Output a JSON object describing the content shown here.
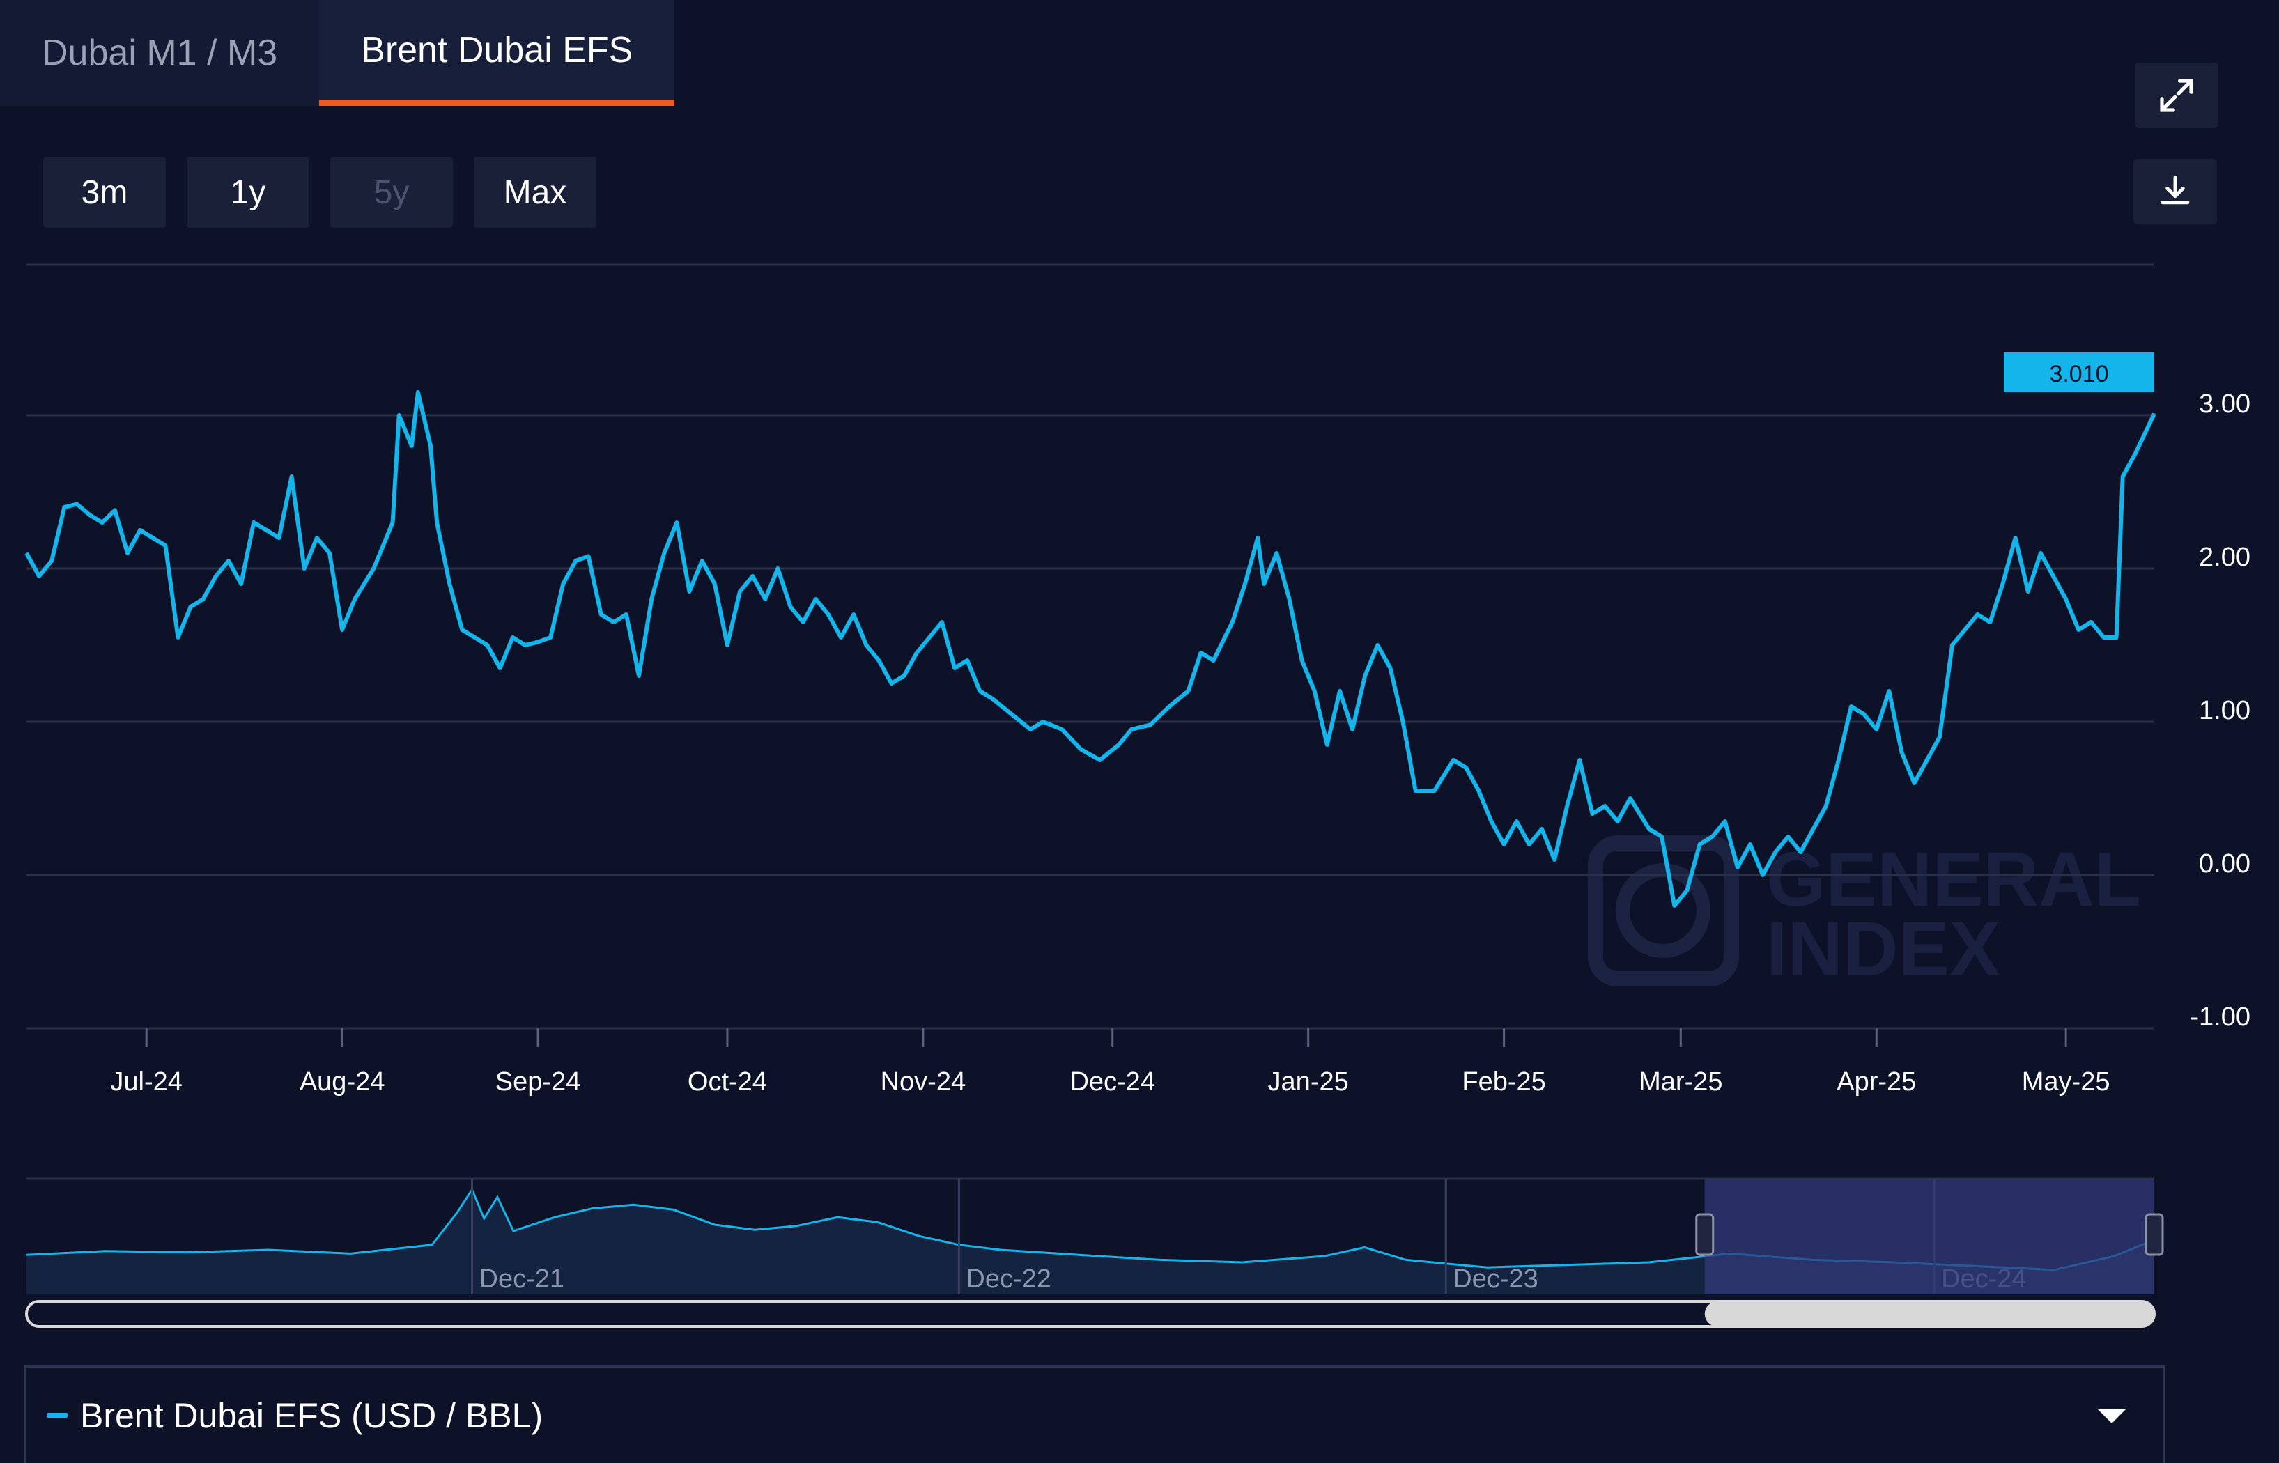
{
  "tabs": [
    {
      "label": "Dubai M1 / M3",
      "active": false
    },
    {
      "label": "Brent Dubai EFS",
      "active": true
    }
  ],
  "range_buttons": [
    {
      "label": "3m",
      "disabled": false
    },
    {
      "label": "1y",
      "disabled": false
    },
    {
      "label": "5y",
      "disabled": true
    },
    {
      "label": "Max",
      "disabled": false
    }
  ],
  "icons": {
    "expand": "expand-icon",
    "download": "download-icon",
    "dropdown": "chevron-down-icon"
  },
  "colors": {
    "background": "#0d1229",
    "series": "#13b5ea",
    "tab_active": "#f05a1e",
    "navigator_selection": "#323a7a"
  },
  "watermark": {
    "line1": "GENERAL",
    "line2": "INDEX"
  },
  "legend": {
    "label": "Brent Dubai EFS (USD / BBL)"
  },
  "chart_data": {
    "type": "line",
    "title": "",
    "xlabel": "",
    "ylabel": "",
    "ylim": [
      -1.0,
      3.9
    ],
    "yticks": [
      "3.00",
      "2.00",
      "1.00",
      "0.00",
      "-1.00"
    ],
    "xticks": [
      "Jul-24",
      "Aug-24",
      "Sep-24",
      "Oct-24",
      "Nov-24",
      "Dec-24",
      "Jan-25",
      "Feb-25",
      "Mar-25",
      "Apr-25",
      "May-25"
    ],
    "last_value_label": "3.010",
    "grid": true,
    "series": [
      {
        "name": "Brent Dubai EFS (USD / BBL)",
        "points": [
          [
            "2024-06-12",
            2.1
          ],
          [
            "2024-06-14",
            1.95
          ],
          [
            "2024-06-16",
            2.05
          ],
          [
            "2024-06-18",
            2.4
          ],
          [
            "2024-06-20",
            2.42
          ],
          [
            "2024-06-22",
            2.35
          ],
          [
            "2024-06-24",
            2.3
          ],
          [
            "2024-06-26",
            2.38
          ],
          [
            "2024-06-28",
            2.1
          ],
          [
            "2024-06-30",
            2.25
          ],
          [
            "2024-07-02",
            2.2
          ],
          [
            "2024-07-04",
            2.15
          ],
          [
            "2024-07-06",
            1.55
          ],
          [
            "2024-07-08",
            1.75
          ],
          [
            "2024-07-10",
            1.8
          ],
          [
            "2024-07-12",
            1.95
          ],
          [
            "2024-07-14",
            2.05
          ],
          [
            "2024-07-16",
            1.9
          ],
          [
            "2024-07-18",
            2.3
          ],
          [
            "2024-07-20",
            2.25
          ],
          [
            "2024-07-22",
            2.2
          ],
          [
            "2024-07-24",
            2.6
          ],
          [
            "2024-07-26",
            2.0
          ],
          [
            "2024-07-28",
            2.2
          ],
          [
            "2024-07-30",
            2.1
          ],
          [
            "2024-08-01",
            1.6
          ],
          [
            "2024-08-03",
            1.8
          ],
          [
            "2024-08-06",
            2.0
          ],
          [
            "2024-08-09",
            2.3
          ],
          [
            "2024-08-10",
            3.0
          ],
          [
            "2024-08-12",
            2.8
          ],
          [
            "2024-08-13",
            3.15
          ],
          [
            "2024-08-15",
            2.8
          ],
          [
            "2024-08-16",
            2.3
          ],
          [
            "2024-08-18",
            1.9
          ],
          [
            "2024-08-20",
            1.6
          ],
          [
            "2024-08-22",
            1.55
          ],
          [
            "2024-08-24",
            1.5
          ],
          [
            "2024-08-26",
            1.35
          ],
          [
            "2024-08-28",
            1.55
          ],
          [
            "2024-08-30",
            1.5
          ],
          [
            "2024-09-01",
            1.52
          ],
          [
            "2024-09-03",
            1.55
          ],
          [
            "2024-09-05",
            1.9
          ],
          [
            "2024-09-07",
            2.05
          ],
          [
            "2024-09-09",
            2.08
          ],
          [
            "2024-09-11",
            1.7
          ],
          [
            "2024-09-13",
            1.65
          ],
          [
            "2024-09-15",
            1.7
          ],
          [
            "2024-09-17",
            1.3
          ],
          [
            "2024-09-19",
            1.8
          ],
          [
            "2024-09-21",
            2.1
          ],
          [
            "2024-09-23",
            2.3
          ],
          [
            "2024-09-25",
            1.85
          ],
          [
            "2024-09-27",
            2.05
          ],
          [
            "2024-09-29",
            1.9
          ],
          [
            "2024-10-01",
            1.5
          ],
          [
            "2024-10-03",
            1.85
          ],
          [
            "2024-10-05",
            1.95
          ],
          [
            "2024-10-07",
            1.8
          ],
          [
            "2024-10-09",
            2.0
          ],
          [
            "2024-10-11",
            1.75
          ],
          [
            "2024-10-13",
            1.65
          ],
          [
            "2024-10-15",
            1.8
          ],
          [
            "2024-10-17",
            1.7
          ],
          [
            "2024-10-19",
            1.55
          ],
          [
            "2024-10-21",
            1.7
          ],
          [
            "2024-10-23",
            1.5
          ],
          [
            "2024-10-25",
            1.4
          ],
          [
            "2024-10-27",
            1.25
          ],
          [
            "2024-10-29",
            1.3
          ],
          [
            "2024-10-31",
            1.45
          ],
          [
            "2024-11-02",
            1.55
          ],
          [
            "2024-11-04",
            1.65
          ],
          [
            "2024-11-06",
            1.35
          ],
          [
            "2024-11-08",
            1.4
          ],
          [
            "2024-11-10",
            1.2
          ],
          [
            "2024-11-12",
            1.15
          ],
          [
            "2024-11-15",
            1.05
          ],
          [
            "2024-11-18",
            0.95
          ],
          [
            "2024-11-20",
            1.0
          ],
          [
            "2024-11-23",
            0.95
          ],
          [
            "2024-11-26",
            0.82
          ],
          [
            "2024-11-29",
            0.75
          ],
          [
            "2024-12-02",
            0.85
          ],
          [
            "2024-12-04",
            0.95
          ],
          [
            "2024-12-07",
            0.98
          ],
          [
            "2024-12-10",
            1.1
          ],
          [
            "2024-12-13",
            1.2
          ],
          [
            "2024-12-15",
            1.45
          ],
          [
            "2024-12-17",
            1.4
          ],
          [
            "2024-12-20",
            1.65
          ],
          [
            "2024-12-22",
            1.9
          ],
          [
            "2024-12-24",
            2.2
          ],
          [
            "2024-12-25",
            1.9
          ],
          [
            "2024-12-27",
            2.1
          ],
          [
            "2024-12-29",
            1.8
          ],
          [
            "2024-12-31",
            1.4
          ],
          [
            "2025-01-02",
            1.2
          ],
          [
            "2025-01-04",
            0.85
          ],
          [
            "2025-01-06",
            1.2
          ],
          [
            "2025-01-08",
            0.95
          ],
          [
            "2025-01-10",
            1.3
          ],
          [
            "2025-01-12",
            1.5
          ],
          [
            "2025-01-14",
            1.35
          ],
          [
            "2025-01-16",
            1.0
          ],
          [
            "2025-01-18",
            0.55
          ],
          [
            "2025-01-21",
            0.55
          ],
          [
            "2025-01-24",
            0.75
          ],
          [
            "2025-01-26",
            0.7
          ],
          [
            "2025-01-28",
            0.55
          ],
          [
            "2025-01-30",
            0.35
          ],
          [
            "2025-02-01",
            0.2
          ],
          [
            "2025-02-03",
            0.35
          ],
          [
            "2025-02-05",
            0.2
          ],
          [
            "2025-02-07",
            0.3
          ],
          [
            "2025-02-09",
            0.1
          ],
          [
            "2025-02-11",
            0.45
          ],
          [
            "2025-02-13",
            0.75
          ],
          [
            "2025-02-15",
            0.4
          ],
          [
            "2025-02-17",
            0.45
          ],
          [
            "2025-02-19",
            0.35
          ],
          [
            "2025-02-21",
            0.5
          ],
          [
            "2025-02-24",
            0.3
          ],
          [
            "2025-02-26",
            0.25
          ],
          [
            "2025-02-28",
            -0.2
          ],
          [
            "2025-03-02",
            -0.1
          ],
          [
            "2025-03-04",
            0.2
          ],
          [
            "2025-03-06",
            0.25
          ],
          [
            "2025-03-08",
            0.35
          ],
          [
            "2025-03-10",
            0.05
          ],
          [
            "2025-03-12",
            0.2
          ],
          [
            "2025-03-14",
            0.0
          ],
          [
            "2025-03-16",
            0.15
          ],
          [
            "2025-03-18",
            0.25
          ],
          [
            "2025-03-20",
            0.15
          ],
          [
            "2025-03-22",
            0.3
          ],
          [
            "2025-03-24",
            0.45
          ],
          [
            "2025-03-26",
            0.75
          ],
          [
            "2025-03-28",
            1.1
          ],
          [
            "2025-03-30",
            1.05
          ],
          [
            "2025-04-01",
            0.95
          ],
          [
            "2025-04-03",
            1.2
          ],
          [
            "2025-04-05",
            0.8
          ],
          [
            "2025-04-07",
            0.6
          ],
          [
            "2025-04-09",
            0.75
          ],
          [
            "2025-04-11",
            0.9
          ],
          [
            "2025-04-13",
            1.5
          ],
          [
            "2025-04-15",
            1.6
          ],
          [
            "2025-04-17",
            1.7
          ],
          [
            "2025-04-19",
            1.65
          ],
          [
            "2025-04-21",
            1.9
          ],
          [
            "2025-04-23",
            2.2
          ],
          [
            "2025-04-25",
            1.85
          ],
          [
            "2025-04-27",
            2.1
          ],
          [
            "2025-04-29",
            1.95
          ],
          [
            "2025-05-01",
            1.8
          ],
          [
            "2025-05-03",
            1.6
          ],
          [
            "2025-05-05",
            1.65
          ],
          [
            "2025-05-07",
            1.55
          ],
          [
            "2025-05-09",
            1.55
          ],
          [
            "2025-05-10",
            2.6
          ],
          [
            "2025-05-12",
            2.75
          ],
          [
            "2025-05-15",
            3.01
          ]
        ]
      }
    ],
    "navigator": {
      "labels": [
        "Dec-21",
        "Dec-22",
        "Dec-23",
        "Dec-24"
      ],
      "x_start": "2021-01-01",
      "x_end": "2025-05-15",
      "selection": [
        "2024-06-12",
        "2025-05-15"
      ],
      "values": [
        [
          "2021-01-01",
          1.6
        ],
        [
          "2021-03-01",
          1.9
        ],
        [
          "2021-05-01",
          1.8
        ],
        [
          "2021-07-01",
          2.0
        ],
        [
          "2021-09-01",
          1.7
        ],
        [
          "2021-11-01",
          2.4
        ],
        [
          "2021-11-20",
          5.0
        ],
        [
          "2021-12-01",
          6.8
        ],
        [
          "2021-12-10",
          4.5
        ],
        [
          "2021-12-20",
          6.2
        ],
        [
          "2022-01-01",
          3.5
        ],
        [
          "2022-02-01",
          4.6
        ],
        [
          "2022-03-01",
          5.3
        ],
        [
          "2022-04-01",
          5.6
        ],
        [
          "2022-05-01",
          5.2
        ],
        [
          "2022-06-01",
          4.0
        ],
        [
          "2022-07-01",
          3.6
        ],
        [
          "2022-08-01",
          3.9
        ],
        [
          "2022-09-01",
          4.6
        ],
        [
          "2022-10-01",
          4.2
        ],
        [
          "2022-11-01",
          3.1
        ],
        [
          "2022-12-01",
          2.4
        ],
        [
          "2023-01-01",
          2.0
        ],
        [
          "2023-03-01",
          1.6
        ],
        [
          "2023-05-01",
          1.2
        ],
        [
          "2023-07-01",
          1.0
        ],
        [
          "2023-09-01",
          1.5
        ],
        [
          "2023-10-01",
          2.2
        ],
        [
          "2023-11-01",
          1.2
        ],
        [
          "2024-01-01",
          0.6
        ],
        [
          "2024-03-01",
          0.8
        ],
        [
          "2024-05-01",
          1.0
        ],
        [
          "2024-07-01",
          1.7
        ],
        [
          "2024-09-01",
          1.2
        ],
        [
          "2024-11-01",
          1.0
        ],
        [
          "2025-01-01",
          0.7
        ],
        [
          "2025-03-01",
          0.4
        ],
        [
          "2025-04-15",
          1.5
        ],
        [
          "2025-05-15",
          2.8
        ]
      ]
    }
  }
}
